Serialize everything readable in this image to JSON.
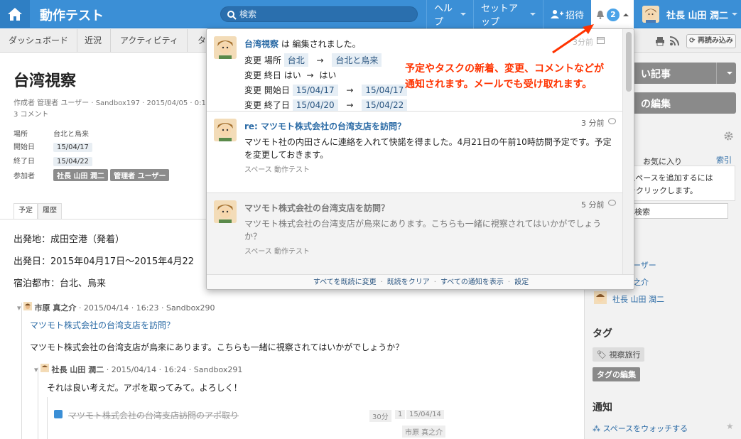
{
  "topbar": {
    "app_title": "動作テスト",
    "search_placeholder": "検索",
    "help": "ヘルプ",
    "setup": "セットアップ",
    "invite": "招待",
    "notif_count": "2",
    "user_name": "社長 山田 潤二",
    "accent": "#3b8fd6"
  },
  "subnav": {
    "tabs": [
      "ダッシュボード",
      "近況",
      "アクティビティ",
      "タ"
    ],
    "reload": "再読み込み"
  },
  "page": {
    "title": "台湾視察",
    "meta": "作成者 管理者 ユーザー · Sandbox197 · 2015/04/05 · 0:1",
    "comment_count": "3 コメント",
    "fields": {
      "place_label": "場所",
      "place_value": "台北と烏来",
      "start_label": "開始日",
      "start_value": "15/04/17",
      "end_label": "終了日",
      "end_value": "15/04/22",
      "attendees_label": "参加者",
      "attendee1": "社長 山田 潤二",
      "attendee2": "管理者 ユーザー"
    },
    "tabs": [
      "予定",
      "履歴"
    ],
    "body": [
      "出発地：成田空港（発着）",
      "出発日：2015年04月17日〜2015年4月22",
      "宿泊都市：台北、烏来"
    ]
  },
  "comments": {
    "c1_author": "市原 真之介",
    "c1_meta": "2015/04/14 · 16:23 · Sandbox290",
    "c1_title": "マツモト株式会社の台湾支店を訪問？",
    "c1_text": "マツモト株式会社の台湾支店が烏來にあります。こちらも一緒に視察されてはいかがでしょうか？",
    "c2_author": "社長 山田 潤二",
    "c2_meta": "2015/04/14 · 16:24 · Sandbox291",
    "c2_text": "それは良い考えだ。アポを取ってみて。よろしく！",
    "task_text": "マツモト株式会社の台湾支店訪問のアポ取り",
    "task_duration": "30分",
    "task_num": "1",
    "task_date": "15/04/14",
    "task_assignee": "市原 真之介"
  },
  "sidebar": {
    "btn1": "い記事",
    "btn2": "の編集",
    "fav_tab": "お気に入り",
    "index_tab": "索引",
    "fav_text1": "にスペースを追加するには",
    "fav_text2": "ンをクリックします。",
    "search_value": "検索",
    "member1": "ユーザー",
    "member2": "真之介",
    "member3": "社長 山田 潤二",
    "tags_title": "タグ",
    "tag1": "視察旅行",
    "tag_edit": "タグの編集",
    "notify_title": "通知",
    "watch": "スペースをウォッチする"
  },
  "notifications": {
    "n1_title": "台湾視察",
    "n1_suffix": "は 編集されました。",
    "n1_time": "3分前",
    "change": "変更",
    "place_label": "場所",
    "place_old": "台北",
    "place_new": "台北と烏来",
    "allday_label": "終日",
    "allday_old": "はい",
    "allday_new": "はい",
    "start_label": "開始日",
    "start_old": "15/04/17",
    "start_new": "15/04/17",
    "end_label": "終了日",
    "end_old": "15/04/20",
    "end_new": "15/04/22",
    "arrow": "→",
    "n2_title": "re: マツモト株式会社の台湾支店を訪問？",
    "n2_time": "3 分前",
    "n2_text1": "マツモト社の内田さんに連絡を入れて快諾を得ました。4月21日の午前10時訪問予定です。予定",
    "n2_text2": "を変更しておきます。",
    "n2_sub": "スペース 動作テスト",
    "n3_title": "マツモト株式会社の台湾支店を訪問？",
    "n3_time": "5 分前",
    "n3_text1": "マツモト株式会社の台湾支店が烏來にあります。こちらも一緒に視察されてはいかがでしょう",
    "n3_text2": "か？",
    "n3_sub": "スペース 動作テスト",
    "footer": [
      "すべてを既読に変更",
      "既読をクリア",
      "すべての通知を表示",
      "設定"
    ]
  },
  "annotation": {
    "line1": "予定やタスクの新着、変更、コメントなどが",
    "line2": "通知されます。メールでも受け取れます。",
    "color": "#ff3300"
  }
}
